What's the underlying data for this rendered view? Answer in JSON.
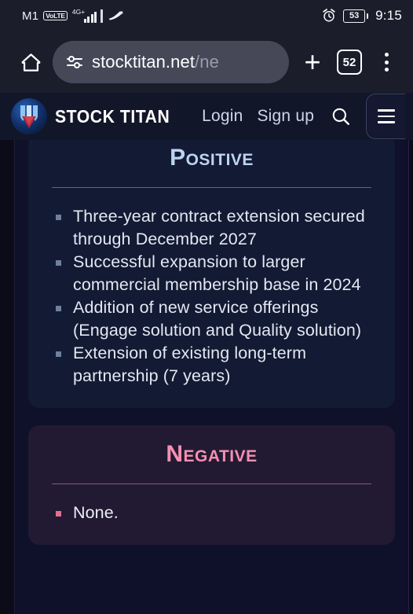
{
  "status_bar": {
    "carrier": "M1",
    "volte_badge": "VoLTE",
    "network_type": "4G+",
    "battery_percent": "53",
    "time": "9:15",
    "alarm_icon": "alarm-clock-icon",
    "vpn_icon": "data-saver-icon"
  },
  "browser": {
    "home_icon": "home-icon",
    "tune_icon": "site-settings-tune-icon",
    "url_domain": "stocktitan.net",
    "url_path": "/ne",
    "new_tab_label": "+",
    "tab_count": "52",
    "menu_icon": "overflow-menu-icon"
  },
  "site_header": {
    "logo_icon": "stock-titan-logo-icon",
    "brand": "STOCK TITAN",
    "login_label": "Login",
    "signup_label": "Sign up",
    "search_icon": "search-icon",
    "menu_icon": "hamburger-menu-icon"
  },
  "content": {
    "positive": {
      "title": "Positive",
      "accent_color": "#bcd4f2",
      "bullets": [
        "Three-year contract extension secured through December 2027",
        "Successful expansion to larger commercial membership base in 2024",
        "Addition of new service offerings (Engage solution and Quality solution)",
        "Extension of existing long-term partnership (7 years)"
      ]
    },
    "negative": {
      "title": "Negative",
      "accent_color": "#f78fae",
      "bullets": [
        "None."
      ]
    }
  }
}
